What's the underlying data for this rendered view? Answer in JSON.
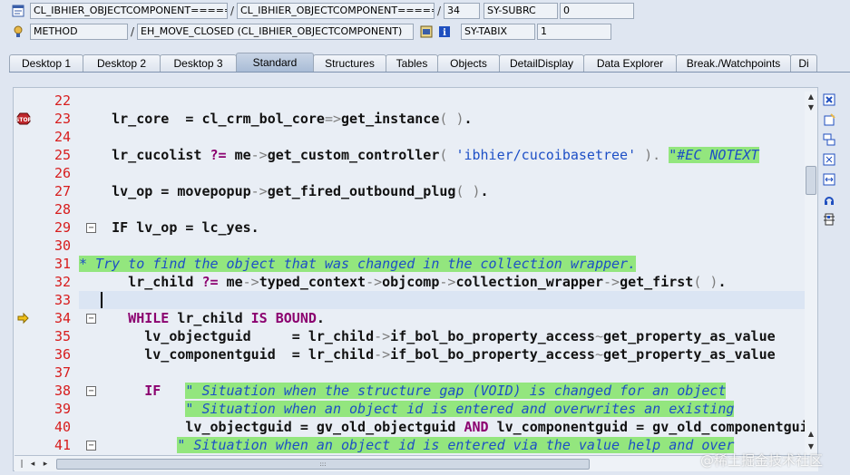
{
  "context": {
    "row1": {
      "program": "CL_IBHIER_OBJECTCOMPONENT=====",
      "include": "CL_IBHIER_OBJECTCOMPONENT=====",
      "line": "34",
      "var_name": "SY-SUBRC",
      "var_value": "0"
    },
    "row2": {
      "event_type": "METHOD",
      "event": "EH_MOVE_CLOSED (CL_IBHIER_OBJECTCOMPONENT)",
      "var_name": "SY-TABIX",
      "var_value": "1"
    }
  },
  "tabs": [
    {
      "label": "Desktop 1"
    },
    {
      "label": "Desktop 2"
    },
    {
      "label": "Desktop 3"
    },
    {
      "label": "Standard",
      "active": true
    },
    {
      "label": "Structures"
    },
    {
      "label": "Tables"
    },
    {
      "label": "Objects"
    },
    {
      "label": "DetailDisplay"
    },
    {
      "label": "Data Explorer"
    },
    {
      "label": "Break./Watchpoints"
    },
    {
      "label": "Di"
    }
  ],
  "editor": {
    "lines": [
      {
        "num": "22",
        "marker": "",
        "fold": false,
        "tokens": []
      },
      {
        "num": "23",
        "marker": "breakpoint",
        "fold": false,
        "tokens": [
          {
            "t": "    lr_core  = cl_crm_bol_core",
            "c": ""
          },
          {
            "t": "=>",
            "c": "op"
          },
          {
            "t": "get_instance",
            "c": ""
          },
          {
            "t": "( ",
            "c": "op"
          },
          {
            "t": ")",
            "c": "op"
          },
          {
            "t": ".",
            "c": ""
          }
        ]
      },
      {
        "num": "24",
        "marker": "",
        "fold": false,
        "tokens": []
      },
      {
        "num": "25",
        "marker": "",
        "fold": false,
        "tokens": [
          {
            "t": "    lr_cucolist ",
            "c": ""
          },
          {
            "t": "?=",
            "c": "kw"
          },
          {
            "t": " me",
            "c": ""
          },
          {
            "t": "->",
            "c": "op"
          },
          {
            "t": "get_custom_controller",
            "c": ""
          },
          {
            "t": "( ",
            "c": "op"
          },
          {
            "t": "'ibhier/cucoibasetree'",
            "c": "str"
          },
          {
            "t": " ). ",
            "c": "op"
          },
          {
            "t": "\"#EC NOTEXT",
            "c": "cm"
          }
        ]
      },
      {
        "num": "26",
        "marker": "",
        "fold": false,
        "tokens": []
      },
      {
        "num": "27",
        "marker": "",
        "fold": false,
        "tokens": [
          {
            "t": "    lv_op = movepopup",
            "c": ""
          },
          {
            "t": "->",
            "c": "op"
          },
          {
            "t": "get_fired_outbound_plug",
            "c": ""
          },
          {
            "t": "( ",
            "c": "op"
          },
          {
            "t": ")",
            "c": "op"
          },
          {
            "t": ".",
            "c": ""
          }
        ]
      },
      {
        "num": "28",
        "marker": "",
        "fold": false,
        "tokens": []
      },
      {
        "num": "29",
        "marker": "",
        "fold": true,
        "tokens": [
          {
            "t": "    IF lv_op = lc_yes.",
            "c": ""
          }
        ]
      },
      {
        "num": "30",
        "marker": "",
        "fold": false,
        "tokens": []
      },
      {
        "num": "31",
        "marker": "",
        "fold": false,
        "tokens": [
          {
            "t": "* Try to find the object that was changed in the collection wrapper.",
            "c": "cm"
          }
        ]
      },
      {
        "num": "32",
        "marker": "",
        "fold": false,
        "tokens": [
          {
            "t": "      lr_child ",
            "c": ""
          },
          {
            "t": "?=",
            "c": "kw"
          },
          {
            "t": " me",
            "c": ""
          },
          {
            "t": "->",
            "c": "op"
          },
          {
            "t": "typed_context",
            "c": ""
          },
          {
            "t": "->",
            "c": "op"
          },
          {
            "t": "objcomp",
            "c": ""
          },
          {
            "t": "->",
            "c": "op"
          },
          {
            "t": "collection_wrapper",
            "c": ""
          },
          {
            "t": "->",
            "c": "op"
          },
          {
            "t": "get_first",
            "c": ""
          },
          {
            "t": "( ",
            "c": "op"
          },
          {
            "t": ")",
            "c": "op"
          },
          {
            "t": ".",
            "c": ""
          }
        ]
      },
      {
        "num": "33",
        "marker": "",
        "fold": false,
        "current": true,
        "tokens": []
      },
      {
        "num": "34",
        "marker": "arrow",
        "fold": true,
        "tokens": [
          {
            "t": "      WHILE",
            "c": "kw"
          },
          {
            "t": " lr_child ",
            "c": ""
          },
          {
            "t": "IS BOUND",
            "c": "kw"
          },
          {
            "t": ".",
            "c": ""
          }
        ]
      },
      {
        "num": "35",
        "marker": "",
        "fold": false,
        "tokens": [
          {
            "t": "        lv_objectguid     = lr_child",
            "c": ""
          },
          {
            "t": "->",
            "c": "op"
          },
          {
            "t": "if_bol_bo_property_access",
            "c": ""
          },
          {
            "t": "~",
            "c": "op"
          },
          {
            "t": "get_property_as_value",
            "c": ""
          }
        ]
      },
      {
        "num": "36",
        "marker": "",
        "fold": false,
        "tokens": [
          {
            "t": "        lv_componentguid  = lr_child",
            "c": ""
          },
          {
            "t": "->",
            "c": "op"
          },
          {
            "t": "if_bol_bo_property_access",
            "c": ""
          },
          {
            "t": "~",
            "c": "op"
          },
          {
            "t": "get_property_as_value",
            "c": ""
          }
        ]
      },
      {
        "num": "37",
        "marker": "",
        "fold": false,
        "tokens": []
      },
      {
        "num": "38",
        "marker": "",
        "fold": true,
        "tokens": [
          {
            "t": "        IF",
            "c": "kw"
          },
          {
            "t": "   ",
            "c": ""
          },
          {
            "t": "\" Situation when the structure gap (VOID) is changed for an object",
            "c": "cm"
          }
        ]
      },
      {
        "num": "39",
        "marker": "",
        "fold": false,
        "tokens": [
          {
            "t": "             ",
            "c": ""
          },
          {
            "t": "\" Situation when an object id is entered and overwrites an existing",
            "c": "cm"
          }
        ]
      },
      {
        "num": "40",
        "marker": "",
        "fold": false,
        "tokens": [
          {
            "t": "             lv_objectguid = gv_old_objectguid ",
            "c": ""
          },
          {
            "t": "AND",
            "c": "kw"
          },
          {
            "t": " lv_componentguid = gv_old_componentguid",
            "c": ""
          }
        ]
      },
      {
        "num": "41",
        "marker": "",
        "fold": true,
        "tokens": [
          {
            "t": "            ",
            "c": ""
          },
          {
            "t": "\" Situation when an object id is entered via the value help and over",
            "c": "cm"
          }
        ]
      }
    ]
  },
  "watermark": "@稀土掘金技术社区",
  "colors": {
    "background": "#dfe6f1",
    "comment_bg": "#93e67e",
    "comment_fg": "#1d4fc6",
    "keyword": "#8b006f",
    "line_number": "#d71d1d"
  }
}
